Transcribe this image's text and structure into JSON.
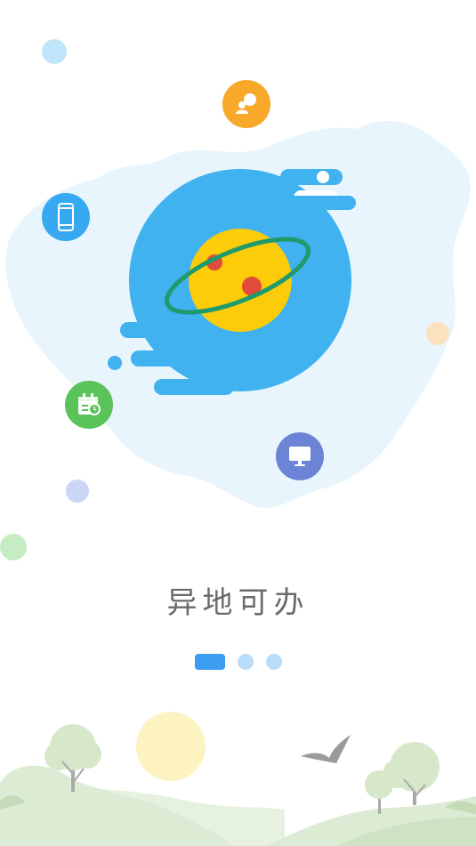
{
  "onboarding": {
    "tagline": "异地可办",
    "page_count": 3,
    "active_page": 1
  },
  "colors": {
    "planet_circle": "#3fb2ef",
    "planet_core": "#fccc0a",
    "planet_ring": "#1e9a6b",
    "map_tint": "#e8f5fd",
    "chat_badge": "#f8a92a",
    "phone_badge": "#36a9f0",
    "calendar_badge": "#5ac35a",
    "desktop_badge": "#6c84d6",
    "pager_active": "#3a9df0",
    "pager_inactive": "#b9dcf9"
  },
  "icons": [
    "chat-person-icon",
    "mobile-phone-icon",
    "calendar-clock-icon",
    "desktop-monitor-icon",
    "planet-illustration",
    "bird-illustration",
    "tree-illustration"
  ]
}
